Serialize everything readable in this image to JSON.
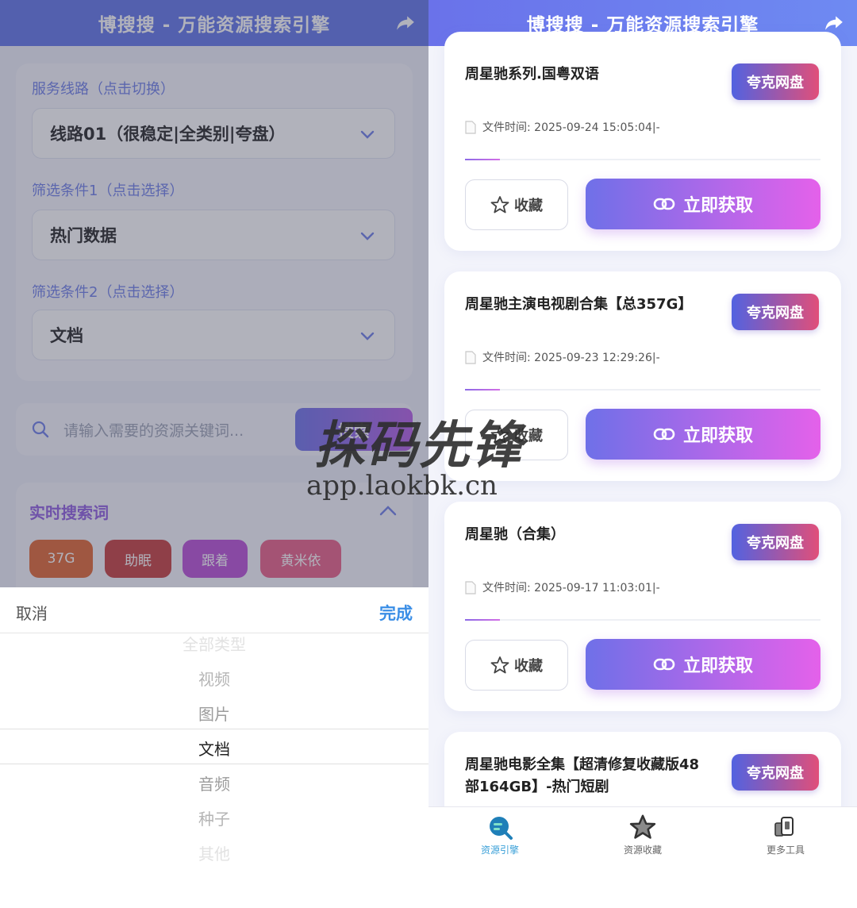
{
  "left": {
    "header_title": "博搜搜 - 万能资源搜索引擎",
    "filters": {
      "route_label": "服务线路（点击切换）",
      "route_value": "线路01（很稳定|全类别|夸盘）",
      "filter1_label": "筛选条件1（点击选择）",
      "filter1_value": "热门数据",
      "filter2_label": "筛选条件2（点击选择）",
      "filter2_value": "文档"
    },
    "search": {
      "placeholder": "请输入需要的资源关键词...",
      "button": "搜索"
    },
    "hot": {
      "title": "实时搜索词",
      "tags": [
        {
          "label": "37G",
          "color": "#e0632e"
        },
        {
          "label": "助眠",
          "color": "#c43a3a"
        },
        {
          "label": "跟着",
          "color": "#b84bd6"
        },
        {
          "label": "黄米依",
          "color": "#e85c86"
        }
      ]
    },
    "picker": {
      "cancel": "取消",
      "done": "完成",
      "options": [
        "全部类型",
        "视频",
        "图片",
        "文档",
        "音频",
        "种子",
        "其他"
      ],
      "selected": "文档"
    }
  },
  "right": {
    "header_title": "博搜搜 - 万能资源搜索引擎",
    "results": [
      {
        "title": "周星驰系列.国粤双语",
        "badge": "夸克网盘",
        "time": "文件时间: 2025-09-24 15:05:04|-",
        "fav": "收藏",
        "get": "立即获取"
      },
      {
        "title": "周星驰主演电视剧合集【总357G】",
        "badge": "夸克网盘",
        "time": "文件时间: 2025-09-23 12:29:26|-",
        "fav": "收藏",
        "get": "立即获取"
      },
      {
        "title": "周星驰（合集）",
        "badge": "夸克网盘",
        "time": "文件时间: 2025-09-17 11:03:01|-",
        "fav": "收藏",
        "get": "立即获取"
      },
      {
        "title": "周星驰电影全集【超清修复收藏版48部164GB】-热门短剧",
        "badge": "夸克网盘"
      }
    ],
    "tabs": [
      {
        "label": "资源引擎",
        "color": "#3aa0d8"
      },
      {
        "label": "资源收藏",
        "color": "#666666"
      },
      {
        "label": "更多工具",
        "color": "#666666"
      }
    ]
  },
  "watermark": {
    "cn": "探码先锋",
    "url": "app.laokbk.cn"
  }
}
